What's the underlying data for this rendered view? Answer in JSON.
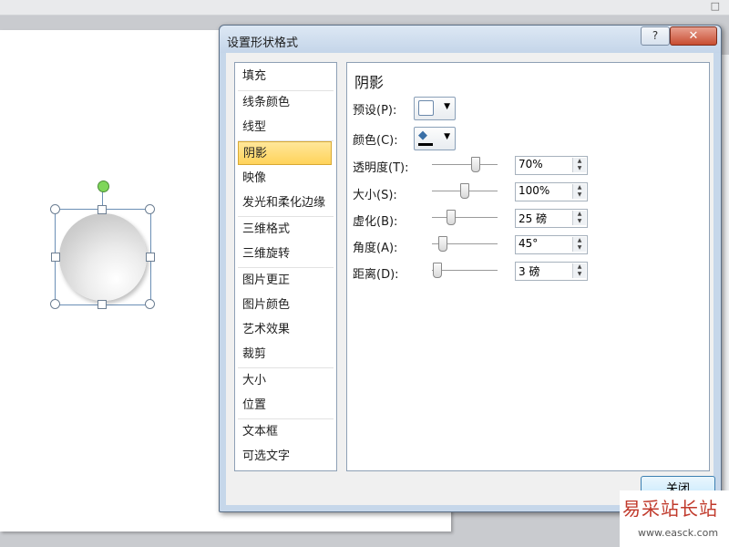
{
  "dialog": {
    "title": "设置形状格式",
    "help_label": "?",
    "close_x_label": "✕",
    "close_button_label": "关闭"
  },
  "nav": {
    "items": [
      "填充",
      "线条颜色",
      "线型",
      "阴影",
      "映像",
      "发光和柔化边缘",
      "三维格式",
      "三维旋转",
      "图片更正",
      "图片颜色",
      "艺术效果",
      "裁剪",
      "大小",
      "位置",
      "文本框",
      "可选文字"
    ],
    "active_index": 3
  },
  "shadow": {
    "heading": "阴影",
    "preset_label": "预设(P):",
    "color_label": "颜色(C):",
    "sliders": [
      {
        "label": "透明度(T):",
        "value": "70%",
        "level": 0.7
      },
      {
        "label": "大小(S):",
        "value": "100%",
        "level": 0.5
      },
      {
        "label": "虚化(B):",
        "value": "25 磅",
        "level": 0.25
      },
      {
        "label": "角度(A):",
        "value": "45°",
        "level": 0.12
      },
      {
        "label": "距离(D):",
        "value": "3 磅",
        "level": 0.02
      }
    ]
  },
  "watermark": {
    "title": "易采站长站",
    "url": "www.easck.com"
  },
  "colors": {
    "active_item": "#ffd35a",
    "rotation_handle": "#7fd65a",
    "close_x": "#c84d31"
  }
}
